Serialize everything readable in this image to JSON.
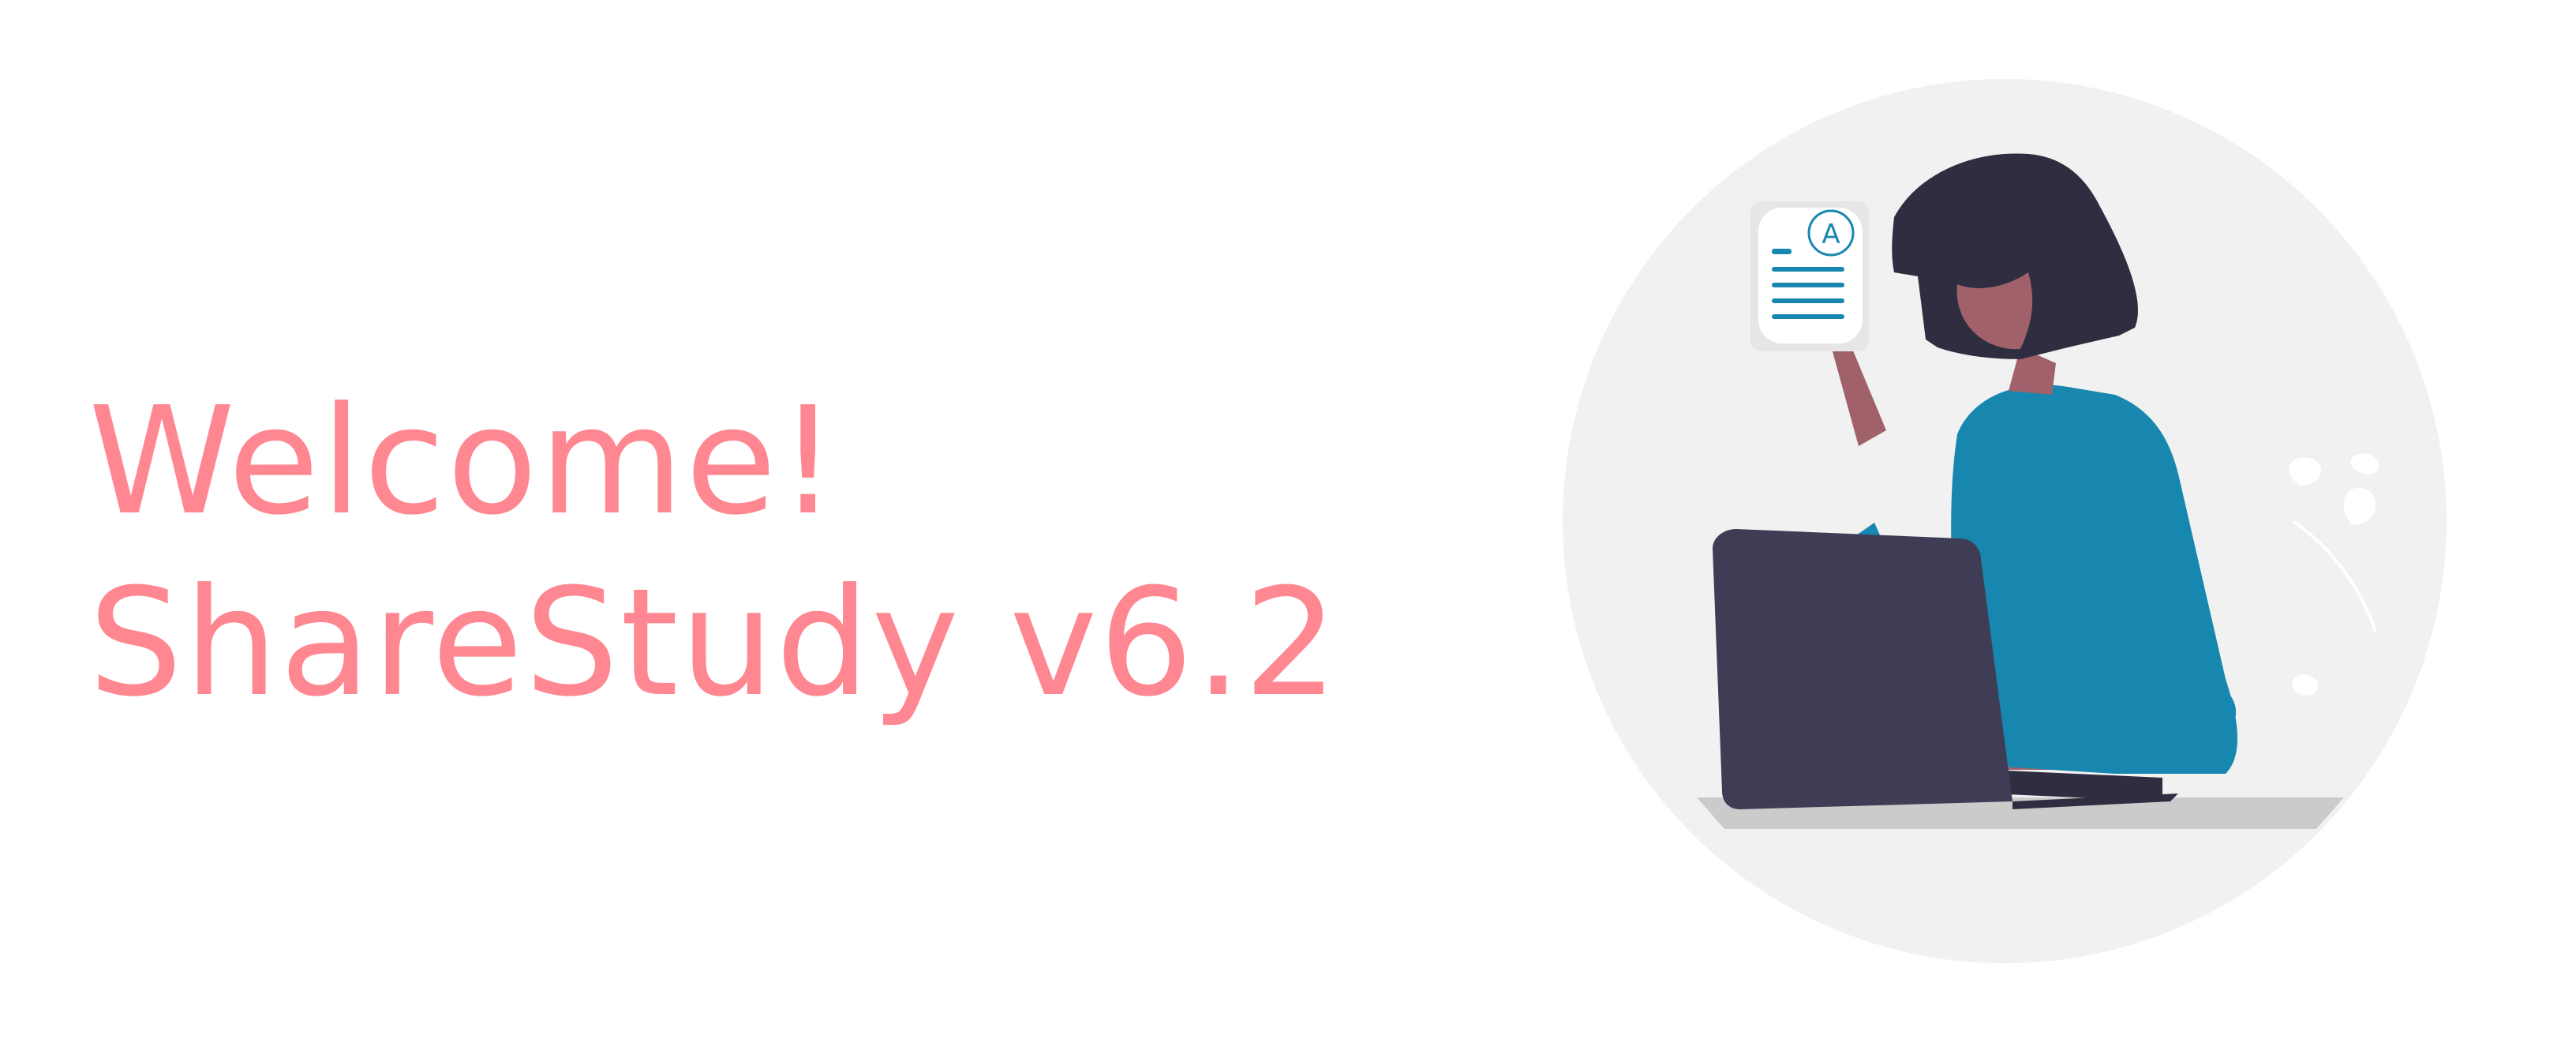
{
  "welcome": {
    "line1": "Welcome!",
    "line2": "ShareStudy v6.2"
  },
  "illustration": {
    "subject": "woman-at-laptop-holding-graded-paper",
    "paper_grade": "A"
  },
  "colors": {
    "accent_text": "#ff8791",
    "background": "#ffffff",
    "circle_bg": "#f1f1f1",
    "shirt": "#1887b0",
    "hair": "#2f2e41",
    "skin": "#a0616a",
    "laptop": "#3f3d56"
  }
}
